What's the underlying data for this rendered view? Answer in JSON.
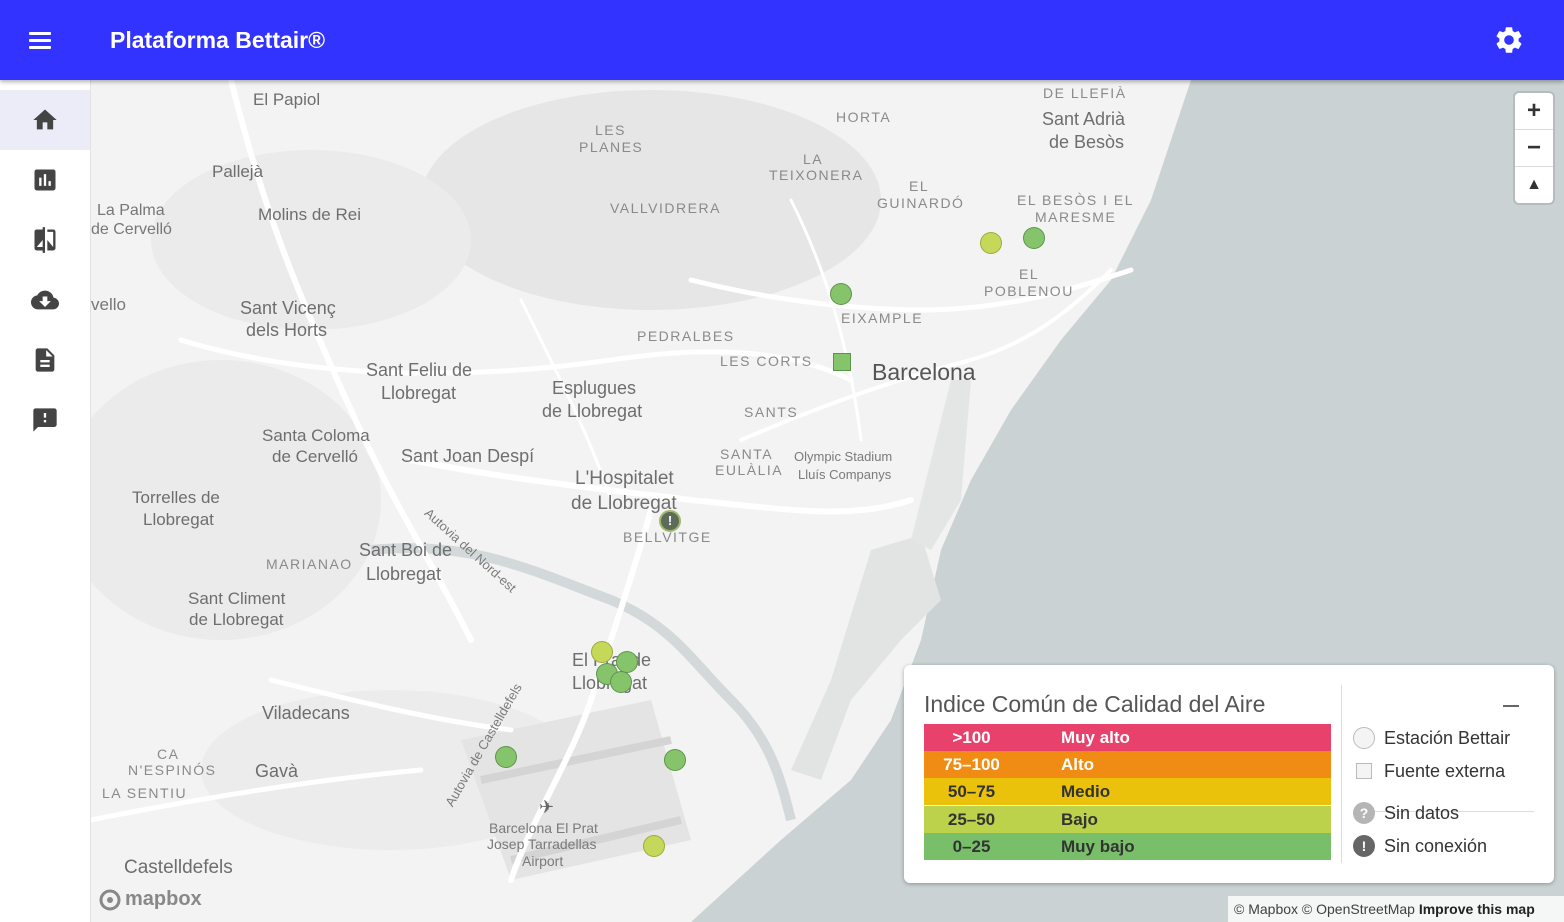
{
  "header": {
    "title": "Plataforma Bettair®",
    "menu_icon": "menu-icon",
    "settings_icon": "gear-icon"
  },
  "sidebar": {
    "items": [
      {
        "name": "home",
        "icon": "home-icon",
        "active": true
      },
      {
        "name": "charts",
        "icon": "bar-chart-icon"
      },
      {
        "name": "compare",
        "icon": "compare-icon"
      },
      {
        "name": "download",
        "icon": "cloud-download-icon"
      },
      {
        "name": "reports",
        "icon": "document-icon"
      },
      {
        "name": "alerts",
        "icon": "feedback-icon"
      }
    ]
  },
  "map": {
    "labels": [
      "El Papiol",
      "DE LLEFIÀ",
      "Sant Adrià",
      "de Besòs",
      "HORTA",
      "LES",
      "PLANES",
      "LA",
      "TEIXONERA",
      "EL",
      "GUINARDÓ",
      "EL BESÒS I EL",
      "MARESME",
      "Pallejà",
      "La Palma",
      "de Cervelló",
      "Molins de Rei",
      "VALLVIDRERA",
      "EL",
      "POBLENOU",
      "vello",
      "Sant Vicenç",
      "dels Horts",
      "EIXAMPLE",
      "PEDRALBES",
      "LES CORTS",
      "Barcelona",
      "Sant Feliu de",
      "Llobregat",
      "Esplugues",
      "de Llobregat",
      "SANTS",
      "Santa Coloma",
      "de Cervelló",
      "Sant Joan Despí",
      "SANTA",
      "EULÀLIA",
      "Olympic Stadium",
      "Lluís Companys",
      "Torrelles de",
      "Llobregat",
      "L'Hospitalet",
      "de Llobregat",
      "BELLVITGE",
      "MARIANAO",
      "Sant Boi de",
      "Llobregat",
      "Autovia del Nord-est",
      "Sant Climent",
      "de Llobregat",
      "El Prat de",
      "Llobregat",
      "Viladecans",
      "CA",
      "N'ESPINÓS",
      "Gavà",
      "LA SENTIU",
      "Autovia de Castelldefels",
      "Barcelona El Prat",
      "Josep Tarradellas",
      "Airport",
      "Castelldefels"
    ],
    "zoom_in": "+",
    "zoom_out": "−",
    "compass": "▲"
  },
  "legend": {
    "title": "Indice Común de Calidad del Aire",
    "collapse_label": "—",
    "scale": [
      {
        "range": ">100",
        "level": "Muy alto",
        "color": "#e8416c"
      },
      {
        "range": "75–100",
        "level": "Alto",
        "color": "#f08c14"
      },
      {
        "range": "50–75",
        "level": "Medio",
        "color": "#ebc20b"
      },
      {
        "range": "25–50",
        "level": "Bajo",
        "color": "#bdd24b"
      },
      {
        "range": "0–25",
        "level": "Muy bajo",
        "color": "#79bf6a"
      }
    ],
    "keys": {
      "station": "Estación Bettair",
      "external": "Fuente externa",
      "no_data": "Sin datos",
      "no_data_symbol": "?",
      "no_connection": "Sin conexión",
      "no_connection_symbol": "!"
    }
  },
  "attribution": {
    "mapbox": "© Mapbox",
    "osm": "© OpenStreetMap",
    "improve": "Improve this map"
  },
  "logo": {
    "text": "mapbox"
  }
}
